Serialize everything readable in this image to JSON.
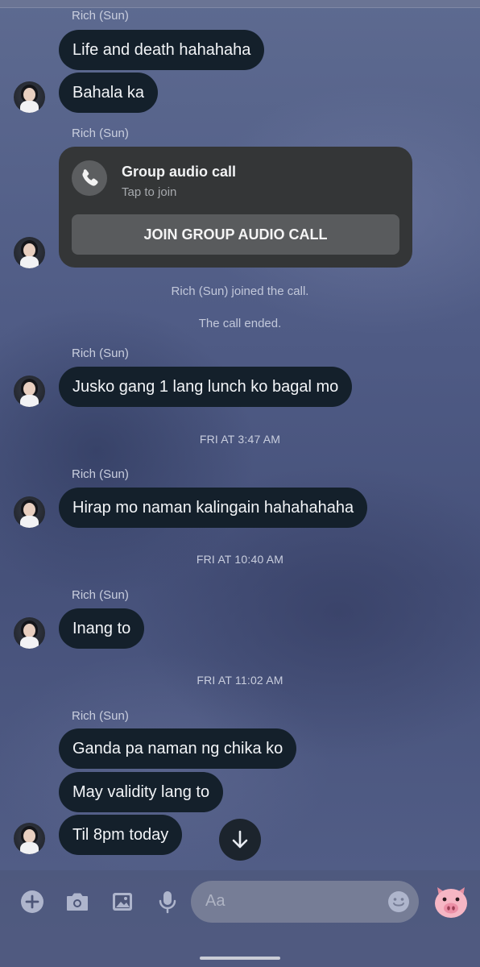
{
  "thread": {
    "sender_name": "Rich (Sun)",
    "msg_life_death": "Life and death hahahaha",
    "msg_bahala": "Bahala ka",
    "call_title": "Group audio call",
    "call_subtitle": "Tap to join",
    "call_button": "JOIN GROUP AUDIO CALL",
    "sys_joined": "Rich (Sun) joined the call.",
    "sys_ended": "The call ended.",
    "msg_jusko": "Jusko gang 1 lang lunch ko bagal mo",
    "ts_1": "FRI AT 3:47 AM",
    "msg_hirap": "Hirap mo naman kalingain hahahahaha",
    "ts_2": "FRI AT 10:40 AM",
    "msg_inang": "Inang to",
    "ts_3": "FRI AT 11:02 AM",
    "msg_ganda": "Ganda pa naman ng chika ko",
    "msg_validity": "May validity lang to",
    "msg_til": "Til 8pm today"
  },
  "composer": {
    "placeholder": "Aa",
    "icons": [
      "plus-icon",
      "camera-icon",
      "gallery-icon",
      "microphone-icon",
      "emoji-icon",
      "pig-sticker-icon"
    ]
  },
  "colors": {
    "bubble": "#14202b",
    "call_card": "#343637",
    "join_button": "#595b5d"
  }
}
